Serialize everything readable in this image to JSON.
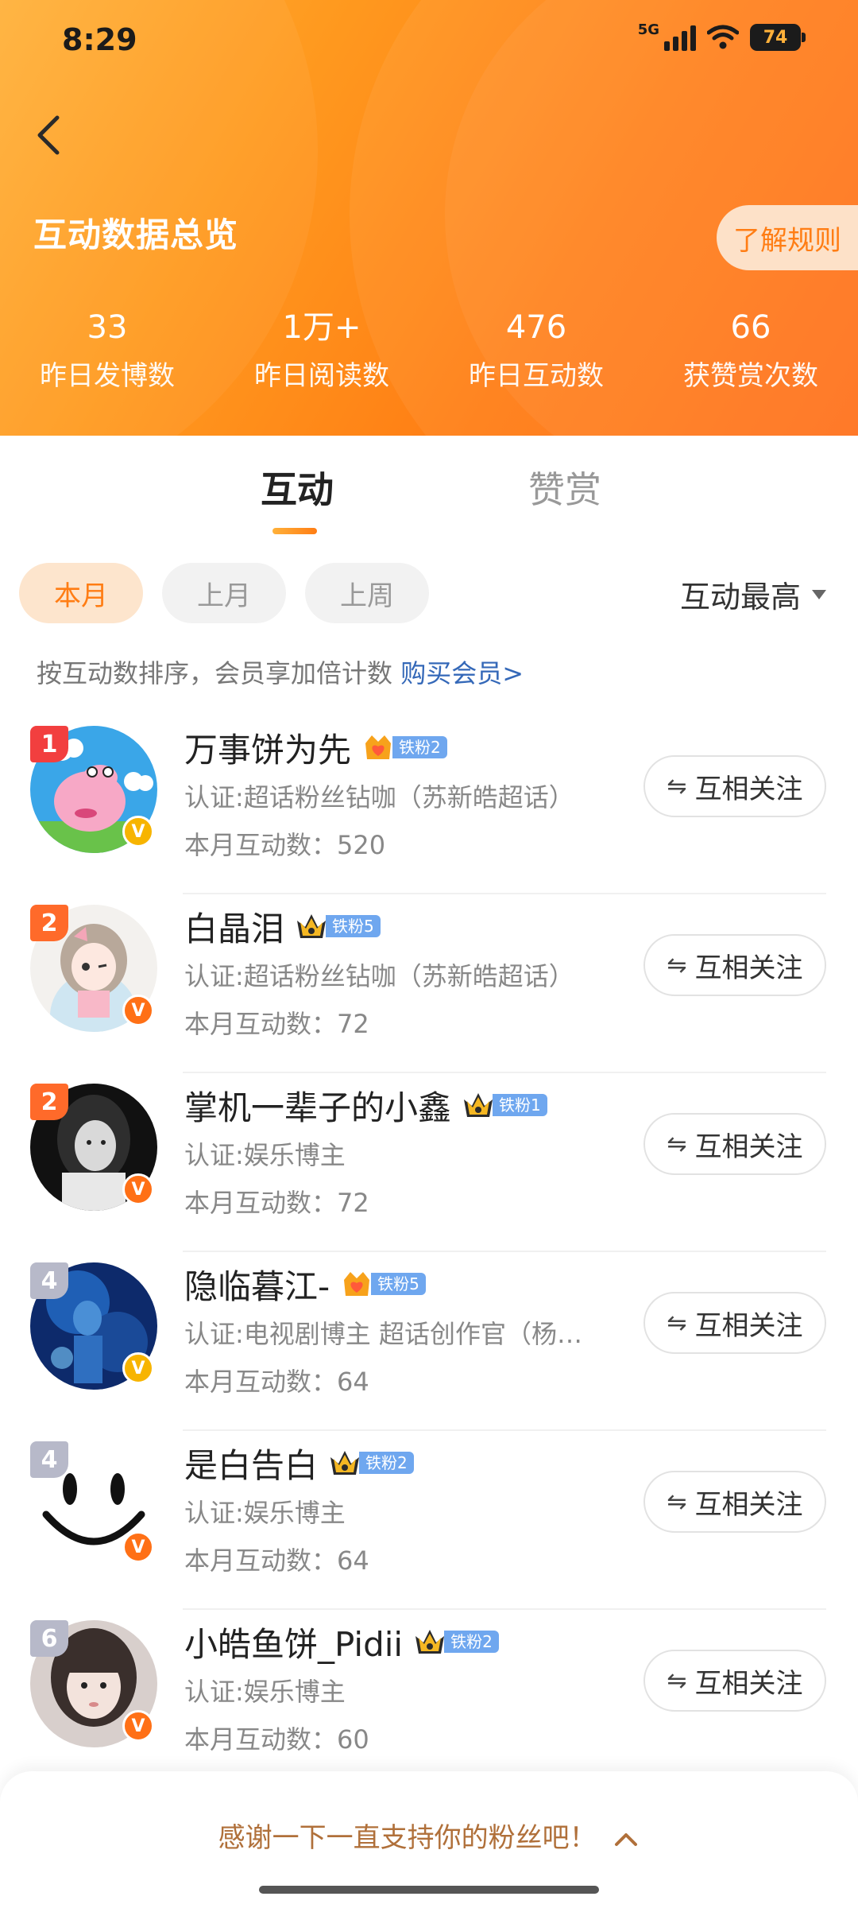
{
  "status_bar": {
    "time": "8:29",
    "network": "5G",
    "battery": "74"
  },
  "header": {
    "title": "互动数据总览",
    "rules_button": "了解规则",
    "stats": [
      {
        "value": "33",
        "label": "昨日发博数"
      },
      {
        "value": "1万+",
        "label": "昨日阅读数"
      },
      {
        "value": "476",
        "label": "昨日互动数"
      },
      {
        "value": "66",
        "label": "获赞赏次数"
      }
    ]
  },
  "tabs": [
    {
      "label": "互动"
    },
    {
      "label": "赞赏"
    }
  ],
  "filters": [
    {
      "label": "本月"
    },
    {
      "label": "上月"
    },
    {
      "label": "上周"
    }
  ],
  "sort": {
    "label": "互动最高"
  },
  "hint": {
    "text": "按互动数排序，会员享加倍计数 ",
    "link": "购买会员>"
  },
  "users": [
    {
      "rank": "1",
      "name": "万事饼为先",
      "badge": "铁粉2",
      "cert": "认证:超话粉丝钻咖（苏新皓超话）",
      "count": "本月互动数：520",
      "button": "互相关注"
    },
    {
      "rank": "2",
      "name": "白晶泪",
      "badge": "铁粉5",
      "cert": "认证:超话粉丝钻咖（苏新皓超话）",
      "count": "本月互动数：72",
      "button": "互相关注"
    },
    {
      "rank": "2",
      "name": "掌机一辈子的小鑫",
      "badge": "铁粉1",
      "cert": "认证:娱乐博主",
      "count": "本月互动数：72",
      "button": "互相关注"
    },
    {
      "rank": "4",
      "name": "隐临暮江-",
      "badge": "铁粉5",
      "cert": "认证:电视剧博主 超话创作官（杨…",
      "count": "本月互动数：64",
      "button": "互相关注"
    },
    {
      "rank": "4",
      "name": "是白告白",
      "badge": "铁粉2",
      "cert": "认证:娱乐博主",
      "count": "本月互动数：64",
      "button": "互相关注"
    },
    {
      "rank": "6",
      "name": "小皓鱼饼_Pidii",
      "badge": "铁粉2",
      "cert": "认证:娱乐博主",
      "count": "本月互动数：60",
      "button": "互相关注"
    }
  ],
  "footer": {
    "thanks": "感谢一下一直支持你的粉丝吧！"
  }
}
